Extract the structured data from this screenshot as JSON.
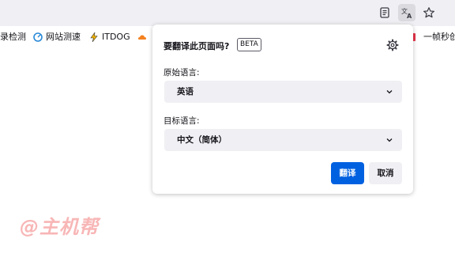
{
  "toolbar": {
    "icons": [
      "reader-view-icon",
      "translate-icon",
      "star-icon"
    ]
  },
  "bookmarks": [
    {
      "label": "录检测",
      "icon": "none"
    },
    {
      "label": "网站测速",
      "icon": "speed-icon"
    },
    {
      "label": "ITDOG",
      "icon": "bolt-icon"
    },
    {
      "label": "",
      "icon": "cloud-icon"
    },
    {
      "label": "一帧秒创",
      "icon": "app-icon"
    }
  ],
  "panel": {
    "title": "要翻译此页面吗?",
    "badge": "BETA",
    "source_label": "原始语言:",
    "source_value": "英语",
    "target_label": "目标语言:",
    "target_value": "中文（简体）",
    "translate_button": "翻译",
    "cancel_button": "取消"
  },
  "watermark": "@主机帮",
  "colors": {
    "primary": "#0061e0",
    "watermark": "#f8b6b6",
    "select_bg": "#f0f0f4"
  }
}
